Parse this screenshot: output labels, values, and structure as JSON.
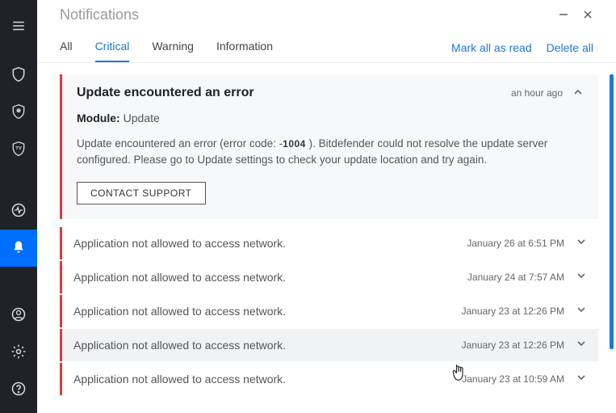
{
  "window": {
    "title": "Notifications"
  },
  "tabs": {
    "all": "All",
    "critical": "Critical",
    "warning": "Warning",
    "information": "Information",
    "active": "critical"
  },
  "actions": {
    "mark_all": "Mark all as read",
    "delete_all": "Delete all"
  },
  "expanded": {
    "title": "Update encountered an error",
    "time": "an hour ago",
    "module_label": "Module:",
    "module_value": "Update",
    "body_pre": "Update encountered an error (error code: -",
    "error_code": "1004",
    "body_post": " ). Bitdefender could not resolve the update server configured. Please go to Update settings to check your update location and try again.",
    "button": "CONTACT SUPPORT"
  },
  "rows": [
    {
      "msg": "Application not allowed to access network.",
      "time": "January 26 at 6:51 PM"
    },
    {
      "msg": "Application not allowed to access network.",
      "time": "January 24 at 7:57 AM"
    },
    {
      "msg": "Application not allowed to access network.",
      "time": "January 23 at 12:26 PM"
    },
    {
      "msg": "Application not allowed to access network.",
      "time": "January 23 at 12:26 PM"
    },
    {
      "msg": "Application not allowed to access network.",
      "time": "January 23 at 10:59 AM"
    }
  ],
  "hovered_row": 3,
  "colors": {
    "accent": "#1e78d6",
    "critical": "#e03a3a",
    "sidebar_bg": "#202228"
  }
}
